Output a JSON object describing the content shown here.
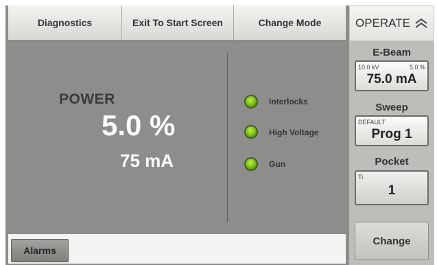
{
  "toolbar": {
    "diagnostics_label": "Diagnostics",
    "exit_label": "Exit To Start Screen",
    "change_mode_label": "Change Mode"
  },
  "power": {
    "label": "POWER",
    "percent": "5.0 %",
    "current": "75 mA"
  },
  "indicators": [
    {
      "label": "Interlocks",
      "status_color": "#7cc21a"
    },
    {
      "label": "High Voltage",
      "status_color": "#7cc21a"
    },
    {
      "label": "Gun",
      "status_color": "#7cc21a"
    }
  ],
  "alarms": {
    "label": "Alarms"
  },
  "sidebar": {
    "mode_label": "OPERATE",
    "mode_icon": "double-chevron-up-icon",
    "ebeam": {
      "title": "E-Beam",
      "voltage": "10.0 kV",
      "percent": "5.0 %",
      "current": "75.0 mA"
    },
    "sweep": {
      "title": "Sweep",
      "preset": "DEFAULT",
      "program": "Prog 1"
    },
    "pocket": {
      "title": "Pocket",
      "material": "Ti",
      "number": "1"
    },
    "change_label": "Change"
  }
}
